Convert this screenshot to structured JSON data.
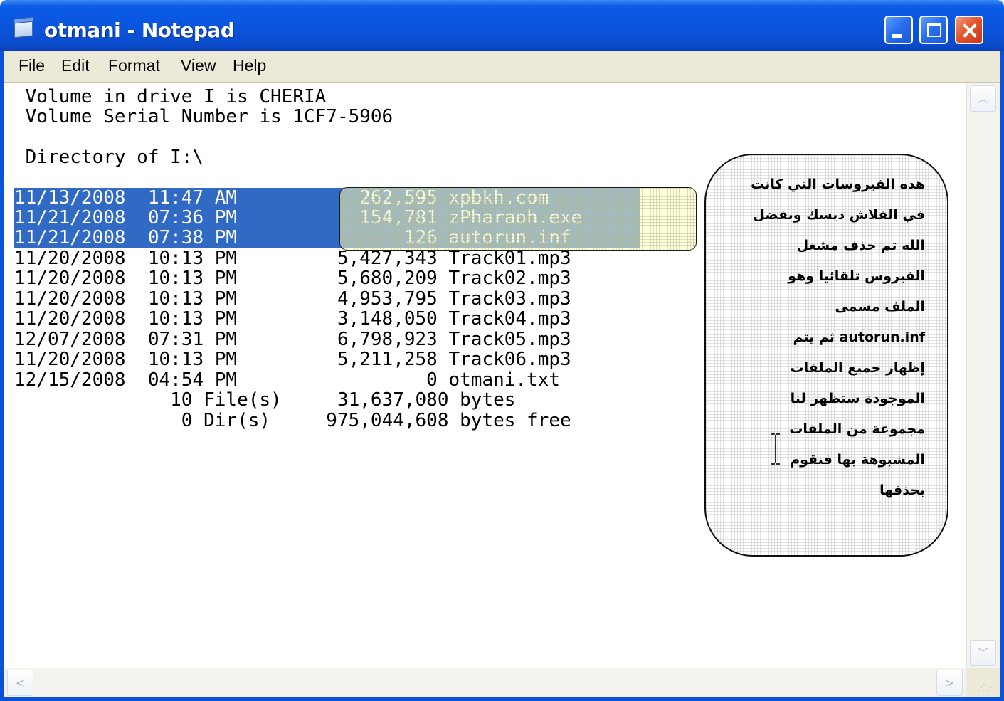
{
  "window": {
    "title": "otmani - Notepad"
  },
  "menu": [
    "File",
    "Edit",
    "Format",
    "View",
    "Help"
  ],
  "document": {
    "lines": [
      " Volume in drive I is CHERIA",
      " Volume Serial Number is 1CF7-5906",
      "",
      " Directory of I:\\",
      "",
      "11/13/2008  11:47 AM           262,595 xpbkh.com",
      "11/21/2008  07:36 PM           154,781 zPharaoh.exe",
      "11/21/2008  07:38 PM               126 autorun.inf",
      "11/20/2008  10:13 PM         5,427,343 Track01.mp3",
      "11/20/2008  10:13 PM         5,680,209 Track02.mp3",
      "11/20/2008  10:13 PM         4,953,795 Track03.mp3",
      "11/20/2008  10:13 PM         3,148,050 Track04.mp3",
      "12/07/2008  07:31 PM         6,798,923 Track05.mp3",
      "11/20/2008  10:13 PM         5,211,258 Track06.mp3",
      "12/15/2008  04:54 PM                 0 otmani.txt",
      "              10 File(s)     31,637,080 bytes",
      "               0 Dir(s)     975,044,608 bytes free"
    ]
  },
  "note": {
    "lines": [
      "هذه الفيروسات التي كانت",
      "في الفلاش ديسك وبفضل",
      "الله تم حذف مشغل",
      "الفيروس تلقائيا وهو",
      "الملف مسمى",
      "autorun.inf ثم يتم",
      "إظهار جميع الملفات",
      "الموجودة ستظهر لنا",
      "مجموعة من الملفات",
      "المشبوهة بها فنقوم",
      "بحذفها"
    ]
  },
  "scrollbar": {
    "up_glyph": "︿",
    "down_glyph": "﹀",
    "left_glyph": "<",
    "right_glyph": ">"
  }
}
